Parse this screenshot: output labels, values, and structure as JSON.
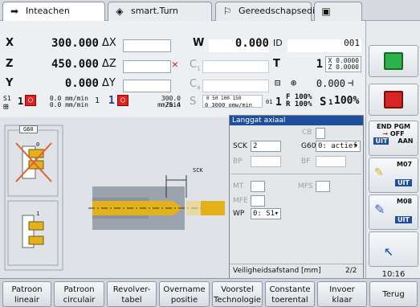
{
  "tabs": [
    {
      "label": "Inteachen",
      "icon": "arrow-right-icon"
    },
    {
      "label": "smart.Turn",
      "icon": "diamond-arrows-icon"
    },
    {
      "label": "Gereedschapseditor",
      "icon": "tool-icon"
    },
    {
      "label": "",
      "icon": "save-icon"
    }
  ],
  "positions": {
    "x": {
      "axis": "X",
      "val": "300.000",
      "delta": "ΔX"
    },
    "z": {
      "axis": "Z",
      "val": "450.000",
      "delta": "ΔZ"
    },
    "y": {
      "axis": "Y",
      "val": "0.000",
      "delta": "ΔY"
    },
    "w": {
      "axis": "W",
      "val": "0.000"
    },
    "id": {
      "label": "ID",
      "val": "001"
    },
    "c1": {
      "label": "C",
      "sub": "1"
    },
    "c4": {
      "label": "C",
      "sub": "4"
    },
    "t": {
      "label": "T",
      "val": "1",
      "x": "X  0.0000",
      "z": "Z  0.0000"
    },
    "coolant_val": "0.000"
  },
  "feed": {
    "s1": "S1",
    "s1_num": "1",
    "feed_a": "0.0 mm/min",
    "feed_b": "0.0 mm/min",
    "num2": "1",
    "num3": "1",
    "spindle": "300.0 mm/min",
    "spindle2": "25.4",
    "scale": "0   50   100  150",
    "range": "0  3000 omw/min",
    "fr": "F 100%",
    "rr": "R 100%",
    "f_num": "1",
    "s_label": "S",
    "s_num": "1",
    "s_pct": "100%",
    "g01": "01"
  },
  "graphic": {
    "g60": "G60",
    "label1": "0",
    "label2": "1",
    "sck": "SCK"
  },
  "dialog": {
    "title": "Langgat axiaal",
    "cb": "CB",
    "sck_label": "SCK",
    "sck_val": "2",
    "g60_label": "G60",
    "g60_val": "0: actief",
    "bp": "BP",
    "bf": "BF",
    "mt": "MT",
    "mfs": "MFS",
    "mfe": "MFE",
    "wp_label": "WP",
    "wp_val": "0: S1",
    "status": "Veiligheidsafstand [mm]",
    "page": "2/2"
  },
  "right": {
    "end_pgm": "END PGM",
    "off": "OFF",
    "uit": "UIT",
    "aan": "AAN",
    "m07": "M07",
    "m07_uit": "UIT",
    "m08": "M08",
    "m08_uit": "UIT",
    "time": "10:16"
  },
  "softkeys": [
    {
      "l1": "Patroon",
      "l2": "lineair"
    },
    {
      "l1": "Patroon",
      "l2": "circulair"
    },
    {
      "l1": "Revolver-",
      "l2": "tabel"
    },
    {
      "l1": "Overname",
      "l2": "positie"
    },
    {
      "l1": "Voorstel",
      "l2": "Technologie"
    },
    {
      "l1": "Constante",
      "l2": "toerental"
    },
    {
      "l1": "Invoer",
      "l2": "klaar"
    },
    {
      "l1": "Terug",
      "l2": ""
    }
  ]
}
